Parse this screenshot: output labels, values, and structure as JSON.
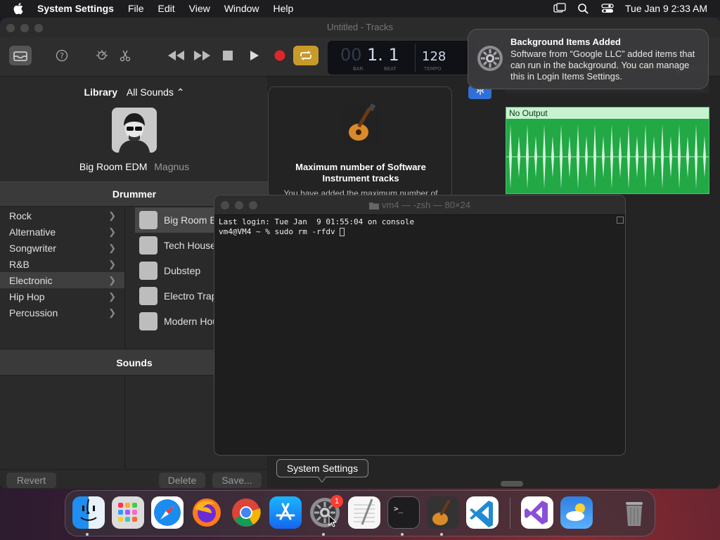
{
  "menubar": {
    "app_name": "System Settings",
    "items": [
      "File",
      "Edit",
      "View",
      "Window",
      "Help"
    ],
    "datetime": "Tue Jan 9  2:33 AM"
  },
  "garageband": {
    "window_title": "Untitled - Tracks",
    "lcd": {
      "bar": "00",
      "beat": "1. 1",
      "bar_label": "BAR",
      "beat_label": "BEAT",
      "tempo": "128",
      "tempo_label": "TEMPO"
    },
    "library": {
      "title": "Library",
      "sounds_selector": "All Sounds ⌃",
      "drummer_name": "Big Room EDM",
      "drummer_person": "Magnus",
      "drummer_section": "Drummer",
      "sounds_section": "Sounds",
      "genres": [
        {
          "label": "Rock",
          "selected": false
        },
        {
          "label": "Alternative",
          "selected": false
        },
        {
          "label": "Songwriter",
          "selected": false
        },
        {
          "label": "R&B",
          "selected": false
        },
        {
          "label": "Electronic",
          "selected": true
        },
        {
          "label": "Hip Hop",
          "selected": false
        },
        {
          "label": "Percussion",
          "selected": false
        }
      ],
      "drummers": [
        {
          "label": "Big Room E",
          "selected": true
        },
        {
          "label": "Tech House",
          "selected": false
        },
        {
          "label": "Dubstep",
          "selected": false
        },
        {
          "label": "Electro Trap",
          "selected": false
        },
        {
          "label": "Modern Hou",
          "selected": false
        }
      ],
      "revert_label": "Revert",
      "delete_label": "Delete",
      "save_label": "Save..."
    },
    "region_label": "No Output",
    "popover": {
      "title_line1": "Maximum number of Software",
      "title_line2": "Instrument tracks",
      "body": "You have added the maximum number of"
    }
  },
  "terminal": {
    "title": "vm4 — -zsh — 80×24",
    "line1": "Last login: Tue Jan  9 01:55:04 on console",
    "line2": "vm4@VM4 ~ % sudo rm -rfdv "
  },
  "notification": {
    "title": "Background Items Added",
    "body": "Software from “Google LLC” added items that can run in the background. You can manage this in Login Items Settings."
  },
  "tooltip": "System Settings",
  "dock": {
    "items": [
      "finder-icon",
      "launchpad-icon",
      "safari-icon",
      "firefox-icon",
      "chrome-icon",
      "app-store-icon",
      "system-settings-icon",
      "textedit-icon",
      "terminal-icon",
      "garageband-icon",
      "vscode-icon",
      "visual-studio-icon",
      "weather-icon",
      "trash-icon"
    ],
    "system_settings_badge": "1"
  }
}
